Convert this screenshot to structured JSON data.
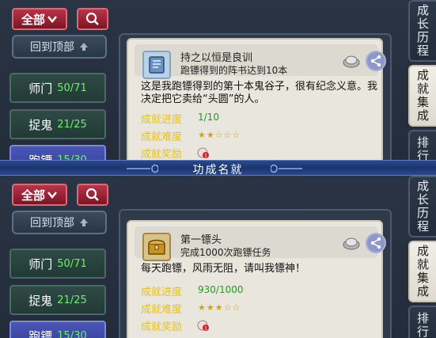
{
  "window_title": "功成名就",
  "toolbar": {
    "filter_label": "全部",
    "filter_icon": "chevron-down-icon",
    "search_icon": "search-icon",
    "back_top_label": "回到顶部",
    "back_top_icon": "arrow-up-icon"
  },
  "categories": [
    {
      "name": "师门",
      "count": "50/71"
    },
    {
      "name": "捉鬼",
      "count": "21/25"
    },
    {
      "name": "跑镖",
      "count": "15/30"
    }
  ],
  "side_tabs": [
    "成长历程",
    "成就集成",
    "排行"
  ],
  "cards": {
    "top": {
      "title": "持之以恒是良训",
      "subtitle": "跑镖得到的阵书达到10本",
      "description": "这是我跑镖得到的第十本鬼谷子，很有纪念义意。我决定把它卖给“头圆”的人。",
      "progress_label": "成就进度",
      "progress_value": "1/10",
      "difficulty_label": "成就难度",
      "difficulty_stars": "★★☆☆☆",
      "difficulty_rating": 2,
      "reward_label": "成就奖励",
      "icon": "book-icon"
    },
    "bottom": {
      "title": "第一镖头",
      "subtitle": "完成1000次跑镖任务",
      "description": "每天跑镖，风雨无阻，请叫我镖神！",
      "progress_label": "成就进度",
      "progress_value": "930/1000",
      "difficulty_label": "成就难度",
      "difficulty_stars": "★★★☆☆",
      "difficulty_rating": 3,
      "reward_label": "成就奖励",
      "icon": "treasure-chest-icon"
    }
  },
  "colors": {
    "accent_red": "#a82438",
    "progress_green": "#16a416",
    "label_yellow": "#e7c21a",
    "active_tab_blue": "#4a56b8"
  }
}
